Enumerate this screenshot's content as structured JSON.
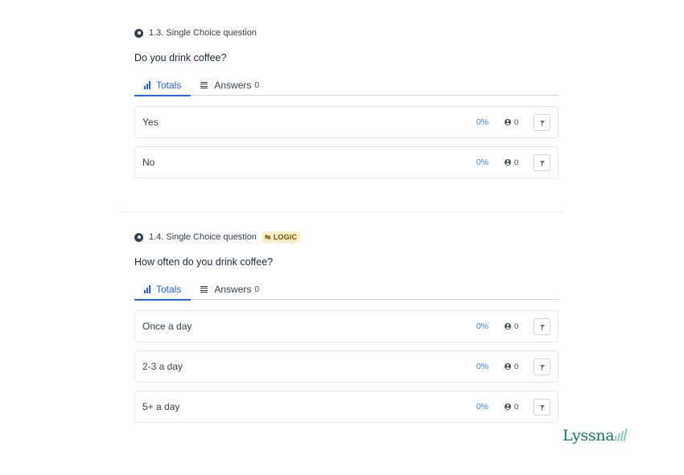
{
  "questions": [
    {
      "header": "1.3. Single Choice question",
      "logic": null,
      "prompt": "Do you drink coffee?",
      "tabs": {
        "totals": "Totals",
        "answers": "Answers",
        "answers_count": "0"
      },
      "options": [
        {
          "label": "Yes",
          "percent": "0%",
          "responses": "0"
        },
        {
          "label": "No",
          "percent": "0%",
          "responses": "0"
        }
      ]
    },
    {
      "header": "1.4. Single Choice question",
      "logic": "LOGIC",
      "prompt": "How often do you drink coffee?",
      "tabs": {
        "totals": "Totals",
        "answers": "Answers",
        "answers_count": "0"
      },
      "options": [
        {
          "label": "Once a day",
          "percent": "0%",
          "responses": "0"
        },
        {
          "label": "2-3 a day",
          "percent": "0%",
          "responses": "0"
        },
        {
          "label": "5+ a day",
          "percent": "0%",
          "responses": "0"
        }
      ]
    }
  ],
  "brand": {
    "name": "Lyssna"
  },
  "colors": {
    "accent": "#2563eb",
    "percent": "#3b82f6",
    "brand": "#0f7a67",
    "logic_badge_bg": "#fdf1c7"
  },
  "icons": [
    "radio-icon",
    "bar-chart-icon",
    "list-icon",
    "person-icon",
    "filter-icon",
    "logic-icon",
    "lyssna-logo"
  ]
}
